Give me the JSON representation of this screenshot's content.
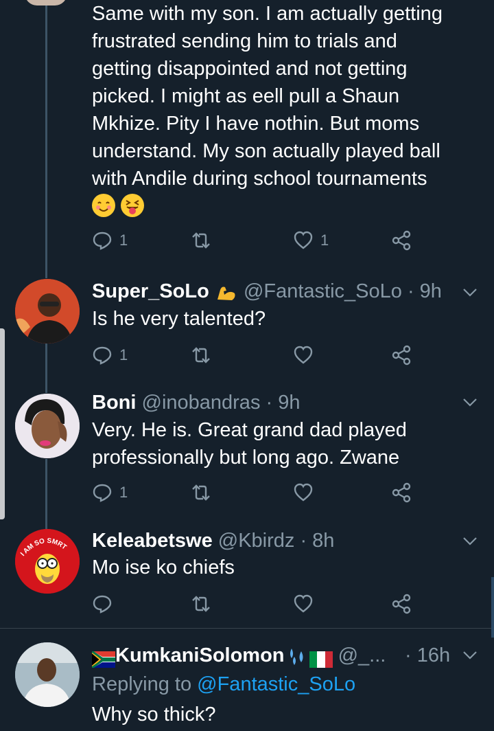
{
  "top_tweet": {
    "text": "Same with my son. I am actually getting\nfrustrated sending him to trials and\ngetting disappointed and not getting\npicked. I might as eell pull a Shaun\nMkhize. Pity I have nothin. But moms\nunderstand. My son actually played ball\nwith Andile during school tournaments",
    "emojis": [
      "smiling-face-icon",
      "squinting-tongue-face-icon"
    ],
    "reply_count": "1",
    "like_count": "1"
  },
  "tweets": [
    {
      "name": "Super_SoLo",
      "name_emoji": "flexed-biceps-icon",
      "handle": "@Fantastic_SoLo",
      "time": "· 9h",
      "text": "Is he very talented?",
      "reply_count": "1",
      "like_count": ""
    },
    {
      "name": "Boni",
      "handle": "@inobandras",
      "time": "· 9h",
      "text": "Very. He is. Great grand dad played\nprofessionally but long ago. Zwane",
      "reply_count": "1",
      "like_count": ""
    },
    {
      "name": "Keleabetswe",
      "handle": "@Kbirdz",
      "time": "· 8h",
      "text": "Mo ise ko chiefs",
      "avatar_text": "I AM SO SMRT",
      "reply_count": "",
      "like_count": ""
    },
    {
      "name": "KumkaniSolomon",
      "handle": "@_...",
      "time": "· 16h",
      "replying_prefix": "Replying to",
      "replying_handle": "@Fantastic_SoLo",
      "text": "Why so thick?"
    }
  ],
  "colors": {
    "background": "#15202b",
    "muted": "#8899a6",
    "link": "#1da1f2",
    "divider": "#38444d"
  }
}
